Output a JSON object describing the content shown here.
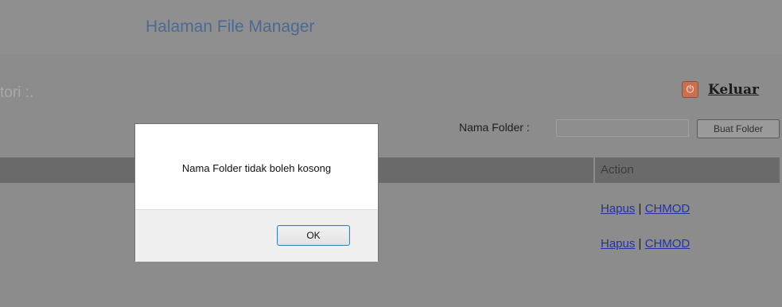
{
  "header": {
    "title": "Halaman File Manager"
  },
  "directory": {
    "label": "tori :."
  },
  "logout": {
    "label": "Keluar"
  },
  "folder_form": {
    "label": "Nama Folder :",
    "value": "",
    "button_label": "Buat Folder"
  },
  "table": {
    "action_header": "Action",
    "rows": [
      {
        "delete_label": "Hapus",
        "separator": "|",
        "chmod_label": "CHMOD"
      },
      {
        "delete_label": "Hapus",
        "separator": "|",
        "chmod_label": "CHMOD"
      }
    ]
  },
  "dialog": {
    "message": "Nama Folder tidak boleh kosong",
    "ok_label": "OK"
  },
  "icons": {
    "logout": "power-icon"
  },
  "colors": {
    "header_title": "#4b6a93",
    "link": "#2631a0",
    "logout_icon": "#c8704f"
  }
}
